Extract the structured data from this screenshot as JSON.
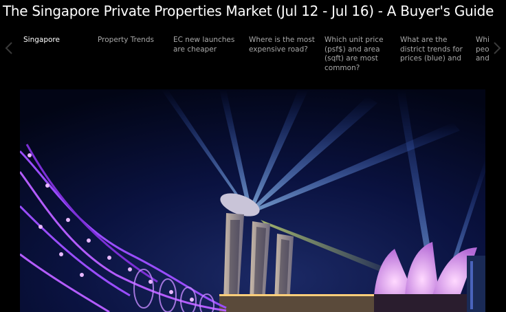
{
  "page": {
    "title": "The Singapore Private Properties Market (Jul 12 - Jul 16) - A Buyer's Guide"
  },
  "tabs": [
    {
      "label": "Singapore",
      "active": true
    },
    {
      "label": "Property Trends",
      "active": false
    },
    {
      "label": "EC new launches are cheaper",
      "active": false
    },
    {
      "label": "Where is the most expensive road?",
      "active": false
    },
    {
      "label": "Which unit price (psf$) and area (sqft) are most common?",
      "active": false
    },
    {
      "label": "What are the district trends for prices (blue) and",
      "active": false
    },
    {
      "label": "Whi peo and",
      "active": false
    }
  ],
  "nav": {
    "prev_icon": "chevron-left-icon",
    "next_icon": "chevron-right-icon"
  },
  "slide": {
    "image": "night-photo-marina-bay-sands-helix-bridge"
  },
  "colors": {
    "background": "#000000",
    "tab_active": "#ffffff",
    "tab_inactive": "#a9a9a9",
    "nav_arrow": "#3a3a3a"
  }
}
